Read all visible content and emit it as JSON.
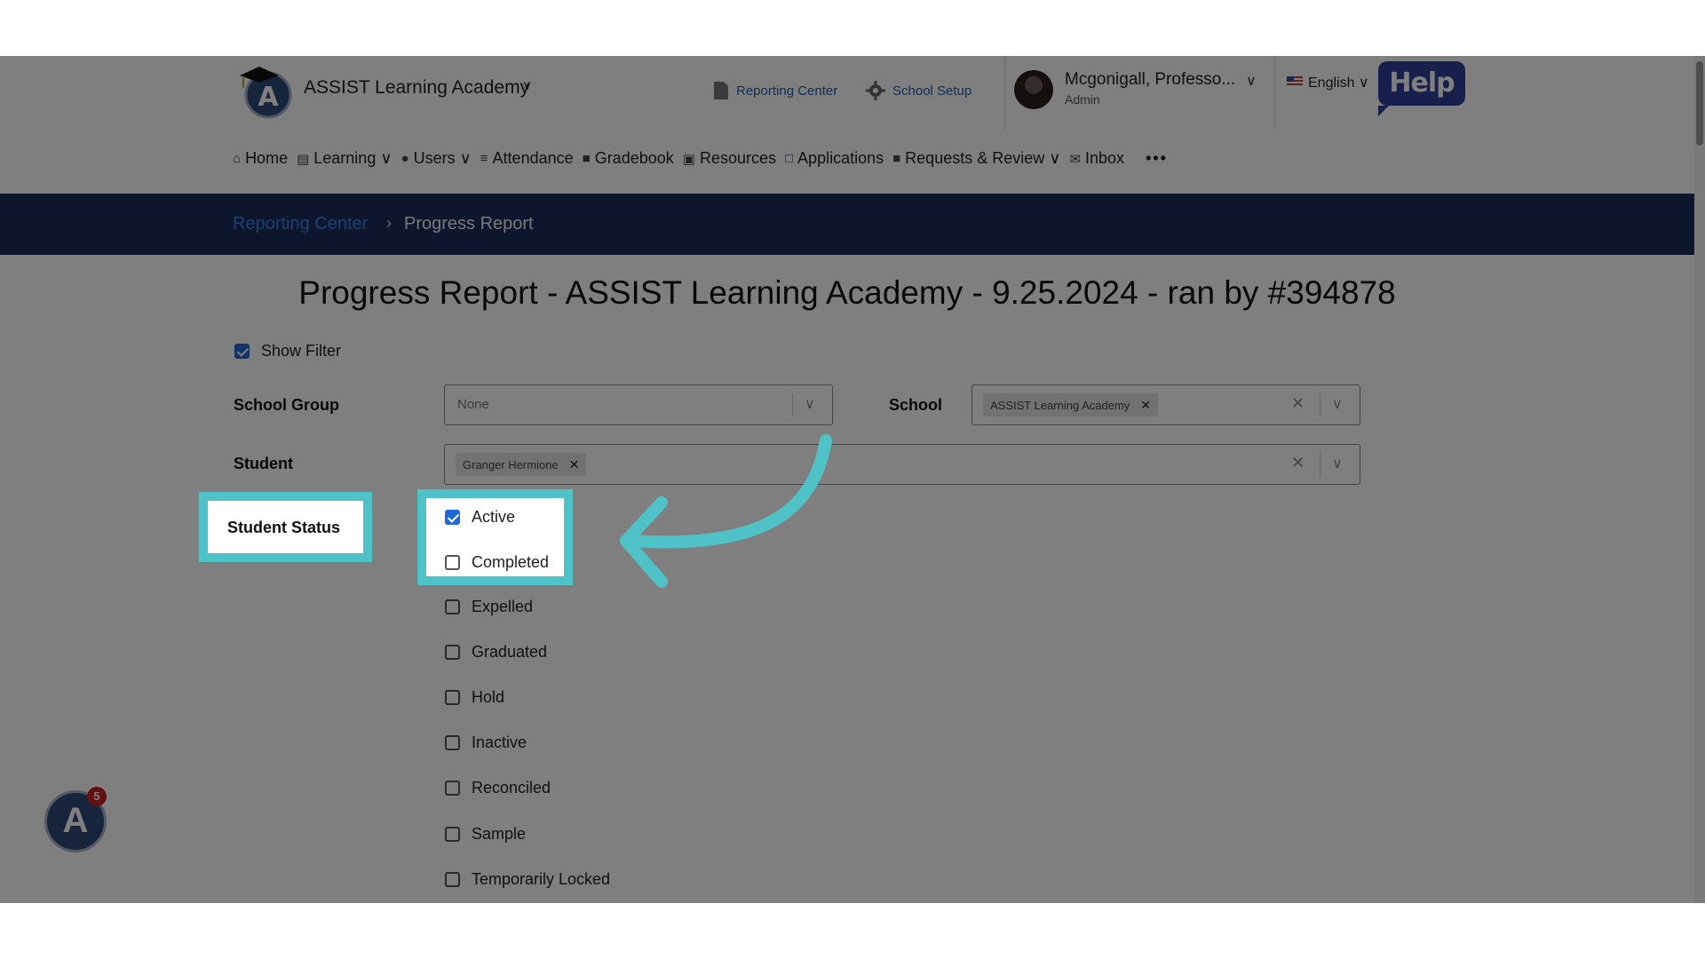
{
  "header": {
    "school_name": "ASSIST Learning Academy",
    "reporting_center": "Reporting Center",
    "school_setup": "School Setup",
    "user_name": "Mcgonigall, Professo...",
    "user_role": "Admin",
    "language": "English",
    "help": "Help"
  },
  "nav": {
    "items": [
      {
        "label": "Home",
        "icon": "home-icon"
      },
      {
        "label": "Learning",
        "icon": "learning-icon"
      },
      {
        "label": "Users",
        "icon": "user-icon"
      },
      {
        "label": "Attendance",
        "icon": "attendance-icon"
      },
      {
        "label": "Gradebook",
        "icon": "gradebook-icon"
      },
      {
        "label": "Resources",
        "icon": "resources-icon"
      },
      {
        "label": "Applications",
        "icon": "chat-icon"
      },
      {
        "label": "Requests & Review",
        "icon": "requests-icon"
      },
      {
        "label": "Inbox",
        "icon": "mail-icon"
      }
    ],
    "more": "•••"
  },
  "breadcrumb": {
    "parent": "Reporting Center",
    "separator": "›",
    "current": "Progress Report"
  },
  "page": {
    "title": "Progress Report - ASSIST Learning Academy - 9.25.2024 - ran by #394878",
    "show_filter": "Show Filter",
    "show_filter_checked": true
  },
  "filters": {
    "school_group_label": "School Group",
    "school_group_value": "None",
    "school_label": "School",
    "school_tag": "ASSIST Learning Academy",
    "student_label": "Student",
    "student_tag": "Granger Hermione",
    "student_status_label": "Student Status",
    "statuses": [
      {
        "label": "Active",
        "checked": true
      },
      {
        "label": "Completed",
        "checked": false
      },
      {
        "label": "Expelled",
        "checked": false
      },
      {
        "label": "Graduated",
        "checked": false
      },
      {
        "label": "Hold",
        "checked": false
      },
      {
        "label": "Inactive",
        "checked": false
      },
      {
        "label": "Reconciled",
        "checked": false
      },
      {
        "label": "Sample",
        "checked": false
      },
      {
        "label": "Temporarily Locked",
        "checked": false
      }
    ]
  },
  "badge": {
    "count": "5"
  },
  "colors": {
    "breadcrumb_bar": "#1c2d5c",
    "highlight": "#4fc2c8",
    "link": "#1f5fa8",
    "help_button": "#2f3f9a",
    "checkbox_checked": "#1e6ad6",
    "badge_count": "#c81e1e"
  }
}
